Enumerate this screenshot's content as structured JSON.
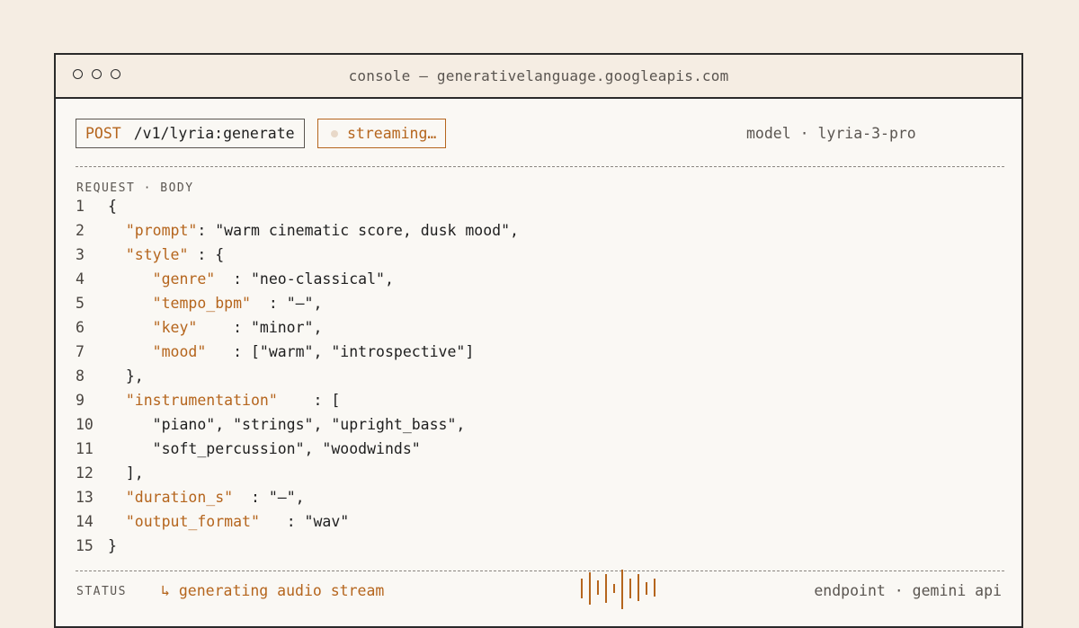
{
  "window": {
    "title": "console — generativelanguage.googleapis.com"
  },
  "request": {
    "method": "POST",
    "path": "/v1/lyria:generate",
    "status_badge": "streaming…",
    "model_label": "model · lyria-3-pro",
    "section_label": "REQUEST · BODY"
  },
  "code_lines": [
    {
      "n": "1",
      "indent": "",
      "key": "",
      "rest": "{"
    },
    {
      "n": "2",
      "indent": "  ",
      "key": "\"prompt\"",
      "rest": ": \"warm cinematic score, dusk mood\","
    },
    {
      "n": "3",
      "indent": "  ",
      "key": "\"style\"",
      "rest": " : {"
    },
    {
      "n": "4",
      "indent": "     ",
      "key": "\"genre\"",
      "rest": "  : \"neo-classical\","
    },
    {
      "n": "5",
      "indent": "     ",
      "key": "\"tempo_bpm\"",
      "rest": "  : \"—\","
    },
    {
      "n": "6",
      "indent": "     ",
      "key": "\"key\"",
      "rest": "    : \"minor\","
    },
    {
      "n": "7",
      "indent": "     ",
      "key": "\"mood\"",
      "rest": "   : [\"warm\", \"introspective\"]"
    },
    {
      "n": "8",
      "indent": "  ",
      "key": "",
      "rest": "},"
    },
    {
      "n": "9",
      "indent": "  ",
      "key": "\"instrumentation\"",
      "rest": "    : ["
    },
    {
      "n": "10",
      "indent": "     ",
      "key": "",
      "rest": "\"piano\", \"strings\", \"upright_bass\","
    },
    {
      "n": "11",
      "indent": "     ",
      "key": "",
      "rest": "\"soft_percussion\", \"woodwinds\""
    },
    {
      "n": "12",
      "indent": "  ",
      "key": "",
      "rest": "],"
    },
    {
      "n": "13",
      "indent": "  ",
      "key": "\"duration_s\"",
      "rest": "  : \"—\","
    },
    {
      "n": "14",
      "indent": "  ",
      "key": "\"output_format\"",
      "rest": "   : \"wav\""
    },
    {
      "n": "15",
      "indent": "",
      "key": "",
      "rest": "}"
    }
  ],
  "status": {
    "label": "STATUS",
    "text": "↳ generating audio stream",
    "endpoint": "endpoint · gemini api"
  },
  "icons": {
    "waveform": "audio-waveform-icon"
  },
  "colors": {
    "accent": "#b5651d",
    "background": "#f5ede3",
    "panel": "#faf8f4"
  }
}
